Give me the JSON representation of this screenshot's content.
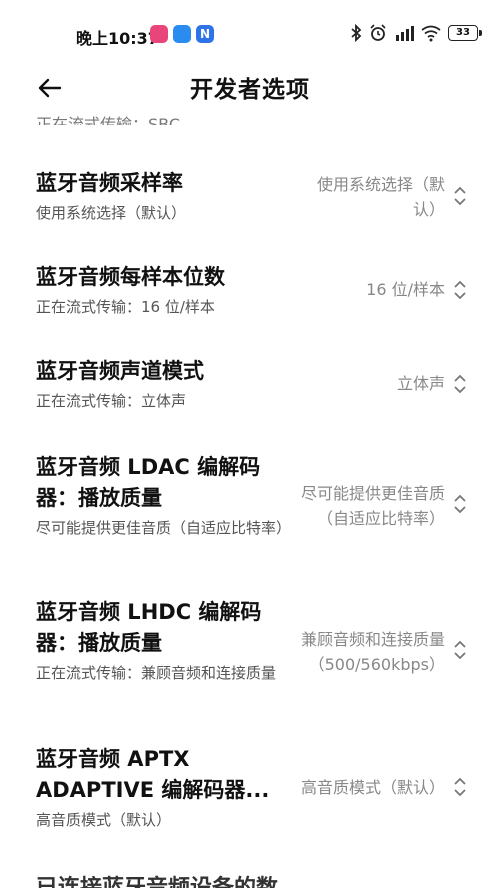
{
  "status_bar": {
    "time": "晚上10:37",
    "battery": "33",
    "app_icon_colors": [
      "#e8457a",
      "#2b8cf0",
      "#2f73e8"
    ]
  },
  "header": {
    "title": "开发者选项"
  },
  "clipped_top_text": "正在流式传输：SBC",
  "rows": [
    {
      "title": "蓝牙音频采样率",
      "subtitle": "使用系统选择（默认）",
      "value": "使用系统选择（默认）"
    },
    {
      "title": "蓝牙音频每样本位数",
      "subtitle": "正在流式传输：16 位/样本",
      "value": "16 位/样本"
    },
    {
      "title": "蓝牙音频声道模式",
      "subtitle": "正在流式传输：立体声",
      "value": "立体声"
    },
    {
      "title": "蓝牙音频 LDAC 编解码器：播放质量",
      "subtitle": "尽可能提供更佳音质（自适应比特率）",
      "value": "尽可能提供更佳音质（自适应比特率）"
    },
    {
      "title": "蓝牙音频 LHDC 编解码器：播放质量",
      "subtitle": "正在流式传输：兼顾音频和连接质量",
      "value": "兼顾音频和连接质量（500/560kbps）"
    },
    {
      "title": "蓝牙音频 APTX ADAPTIVE 编解码器...",
      "subtitle": "高音质模式（默认）",
      "value": "高音质模式（默认）"
    }
  ],
  "clipped_bottom_text": "已连接蓝牙音频设备的数"
}
